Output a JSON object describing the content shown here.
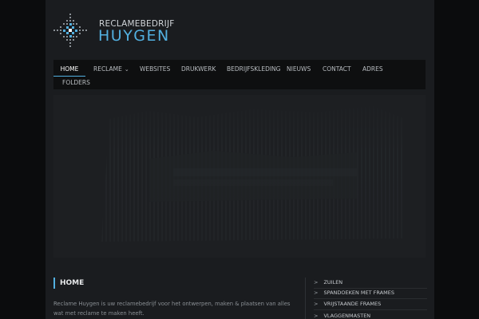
{
  "logo": {
    "line1": "RECLAMEBEDRIJF",
    "line2": "HUYGEN",
    "accent_color": "#52b0e0"
  },
  "nav": {
    "items": [
      {
        "label": "HOME",
        "active": true
      },
      {
        "label": "RECLAME",
        "has_dropdown": true,
        "chevron": "⌄"
      },
      {
        "label": "WEBSITES"
      },
      {
        "label": "DRUKWERK"
      },
      {
        "label": "BEDRIJFSKLEDING"
      },
      {
        "label": "NIEUWS"
      },
      {
        "label": "CONTACT"
      },
      {
        "label": "ADRES"
      },
      {
        "label": "FOLDERS"
      }
    ]
  },
  "main": {
    "title": "HOME",
    "text": "Reclame Huygen is uw reclamebedrijf voor het ontwerpen, maken & plaatsen van alles wat met reclame te maken heeft."
  },
  "sidebar": {
    "arrow": ">",
    "items": [
      {
        "label": "ZUILEN"
      },
      {
        "label": "SPANDOEKEN MET FRAMES"
      },
      {
        "label": "VRIJSTAANDE FRAMES"
      },
      {
        "label": "VLAGGENMASTEN"
      }
    ]
  }
}
